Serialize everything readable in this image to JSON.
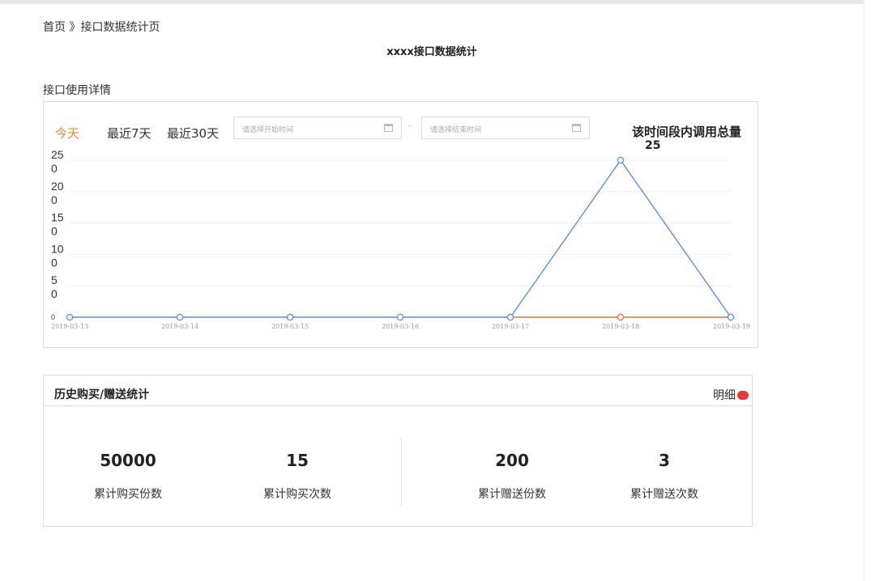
{
  "breadcrumb": "首页 》接口数据统计页",
  "page_title": "xxxx接口数据统计",
  "usage_section": {
    "title": "接口使用详情",
    "tabs": [
      "今天",
      "最近7天",
      "最近30天"
    ],
    "active_tab": "今天",
    "start_placeholder": "请选择开始时间",
    "end_placeholder": "请选择结束时间",
    "date_separator": "–",
    "total_label": "该时间段内调用总量",
    "total_value": "25"
  },
  "chart_data": {
    "type": "line",
    "categories": [
      "2019-03-13",
      "2019-03-14",
      "2019-03-15",
      "2019-03-16",
      "2019-03-17",
      "2019-03-18",
      "2019-03-19"
    ],
    "y_tick_labels": [
      {
        "value": 0,
        "lines": [
          "0"
        ]
      },
      {
        "value": 5,
        "lines": [
          "5",
          "0"
        ]
      },
      {
        "value": 10,
        "lines": [
          "10",
          "0"
        ]
      },
      {
        "value": 15,
        "lines": [
          "15",
          "0"
        ]
      },
      {
        "value": 20,
        "lines": [
          "20",
          "0"
        ]
      },
      {
        "value": 25,
        "lines": [
          "25",
          "0"
        ]
      }
    ],
    "ylim": [
      0,
      25
    ],
    "grid": true,
    "series": [
      {
        "color": "#e8743b",
        "values": [
          null,
          null,
          null,
          null,
          0,
          0,
          0
        ]
      },
      {
        "color": "#5b8ee6",
        "values": [
          0,
          0,
          0,
          0,
          0,
          25,
          0
        ]
      }
    ]
  },
  "stats": {
    "title": "历史购买/赠送统计",
    "detail_link": "明细",
    "items": [
      {
        "value": "50000",
        "label": "累计购买份数"
      },
      {
        "value": "15",
        "label": "累计购买次数"
      },
      {
        "value": "200",
        "label": "累计赠送份数"
      },
      {
        "value": "3",
        "label": "累计赠送次数"
      }
    ]
  },
  "colors": {
    "accent": "#f08a24",
    "line_blue": "#5b8ee6",
    "line_orange": "#e8743b",
    "badge_red": "#e53935"
  }
}
